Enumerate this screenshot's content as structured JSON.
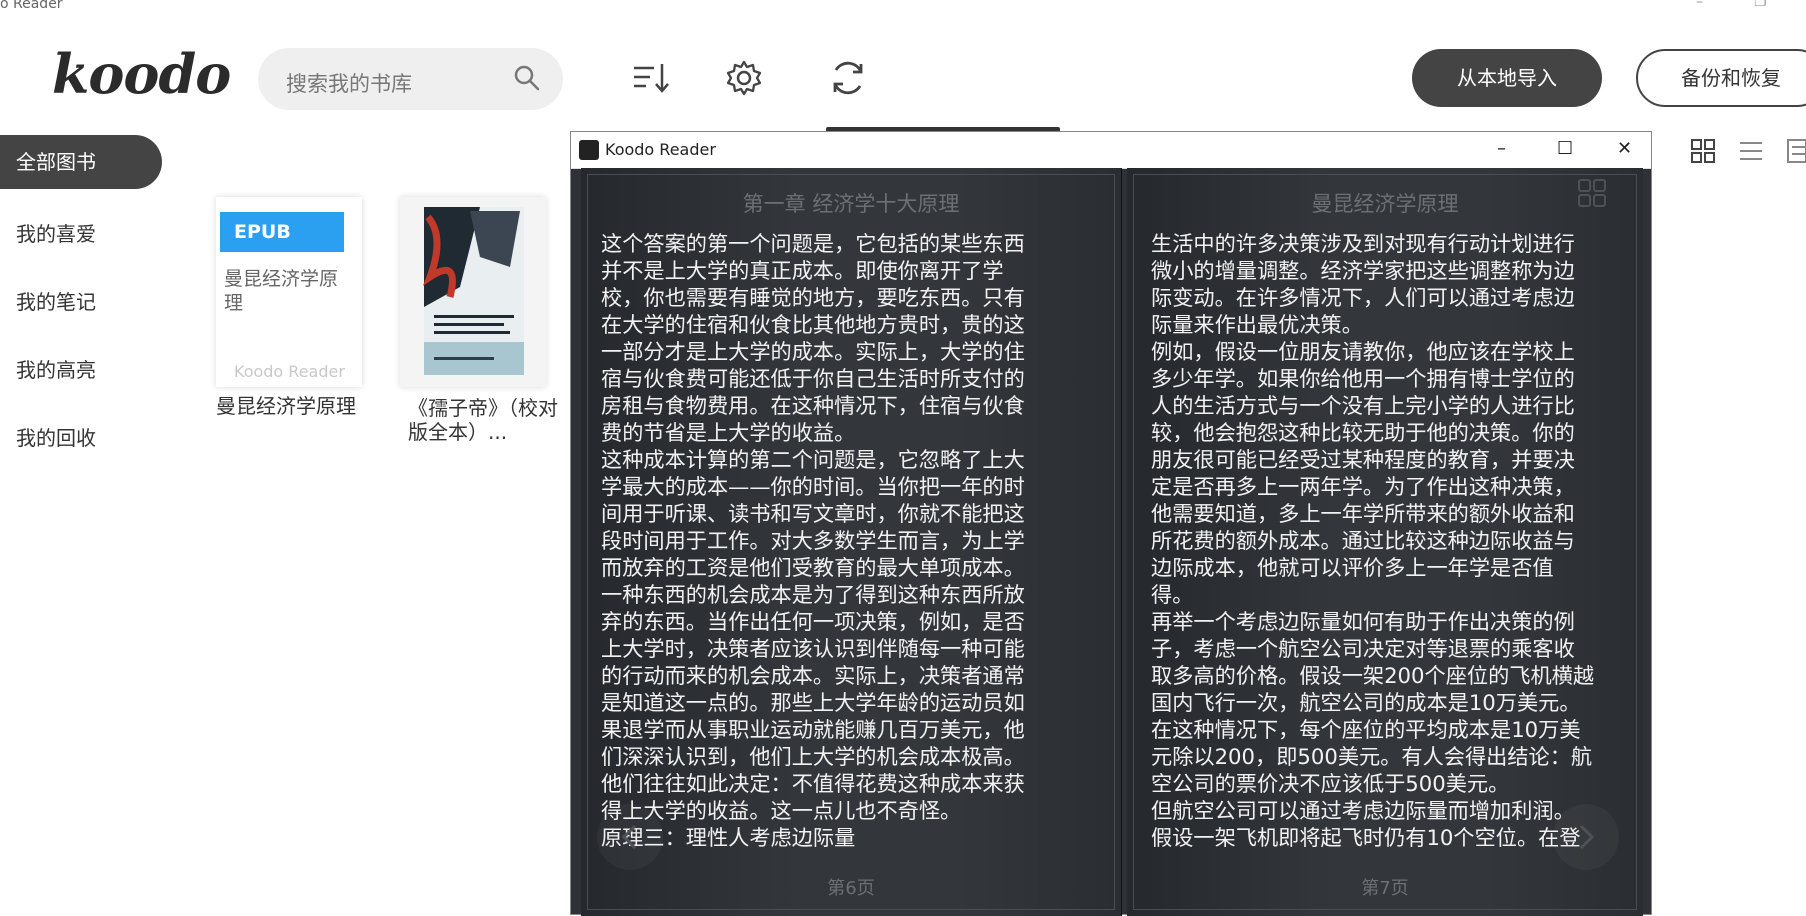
{
  "window": {
    "title": "o Reader"
  },
  "app": {
    "logo": "koodo"
  },
  "search": {
    "placeholder": "搜索我的书库"
  },
  "toolbar": {
    "import_label": "从本地导入",
    "backup_label": "备份和恢复"
  },
  "sidebar": {
    "items": [
      {
        "label": "全部图书",
        "active": true
      },
      {
        "label": "我的喜爱"
      },
      {
        "label": "我的笔记"
      },
      {
        "label": "我的高亮"
      },
      {
        "label": "我的回收"
      }
    ]
  },
  "books": [
    {
      "badge": "EPUB",
      "cover_title": "曼昆经济学原理",
      "cover_footer": "Koodo Reader",
      "name": "曼昆经济学原理"
    },
    {
      "name": "《孺子帝》（校对版全本）..."
    }
  ],
  "reader": {
    "window_title": "Koodo Reader",
    "left_page": {
      "header": "第一章 经济学十大原理",
      "lines": [
        "这个答案的第一个问题是，它包括的某些东西",
        "并不是上大学的真正成本。即使你离开了学",
        "校，你也需要有睡觉的地方，要吃东西。只有",
        "在大学的住宿和伙食比其他地方贵时，贵的这",
        "一部分才是上大学的成本。实际上，大学的住",
        "宿与伙食费可能还低于你自己生活时所支付的",
        "房租与食物费用。在这种情况下，住宿与伙食",
        "费的节省是上大学的收益。",
        "这种成本计算的第二个问题是，它忽略了上大",
        "学最大的成本——你的时间。当你把一年的时",
        "间用于听课、读书和写文章时，你就不能把这",
        "段时间用于工作。对大多数学生而言，为上学",
        "而放弃的工资是他们受教育的最大单项成本。",
        "一种东西的机会成本是为了得到这种东西所放",
        "弃的东西。当作出任何一项决策，例如，是否",
        "上大学时，决策者应该认识到伴随每一种可能",
        "的行动而来的机会成本。实际上，决策者通常",
        "是知道这一点的。那些上大学年龄的运动员如",
        "果退学而从事职业运动就能赚几百万美元，他",
        "们深深认识到，他们上大学的机会成本极高。",
        "他们往往如此决定：不值得花费这种成本来获",
        "得上大学的收益。这一点儿也不奇怪。",
        "原理三：理性人考虑边际量"
      ],
      "footer": "第6页"
    },
    "right_page": {
      "header": "曼昆经济学原理",
      "lines": [
        "生活中的许多决策涉及到对现有行动计划进行",
        "微小的增量调整。经济学家把这些调整称为边",
        "际变动。在许多情况下，人们可以通过考虑边",
        "际量来作出最优决策。",
        "例如，假设一位朋友请教你，他应该在学校上",
        "多少年学。如果你给他用一个拥有博士学位的",
        "人的生活方式与一个没有上完小学的人进行比",
        "较，他会抱怨这种比较无助于他的决策。你的",
        "朋友很可能已经受过某种程度的教育，并要决",
        "定是否再多上一两年学。为了作出这种决策，",
        "他需要知道，多上一年学所带来的额外收益和",
        "所花费的额外成本。通过比较这种边际收益与",
        "边际成本，他就可以评价多上一年学是否值",
        "得。",
        "再举一个考虑边际量如何有助于作出决策的例",
        "子，考虑一个航空公司决定对等退票的乘客收",
        "取多高的价格。假设一架200个座位的飞机横越",
        "国内飞行一次，航空公司的成本是10万美元。",
        "在这种情况下，每个座位的平均成本是10万美",
        "元除以200，即500美元。有人会得出结论：航",
        "空公司的票价决不应该低于500美元。",
        "但航空公司可以通过考虑边际量而增加利润。",
        "假设一架飞机即将起飞时仍有10个空位。在登"
      ],
      "footer": "第7页"
    }
  }
}
